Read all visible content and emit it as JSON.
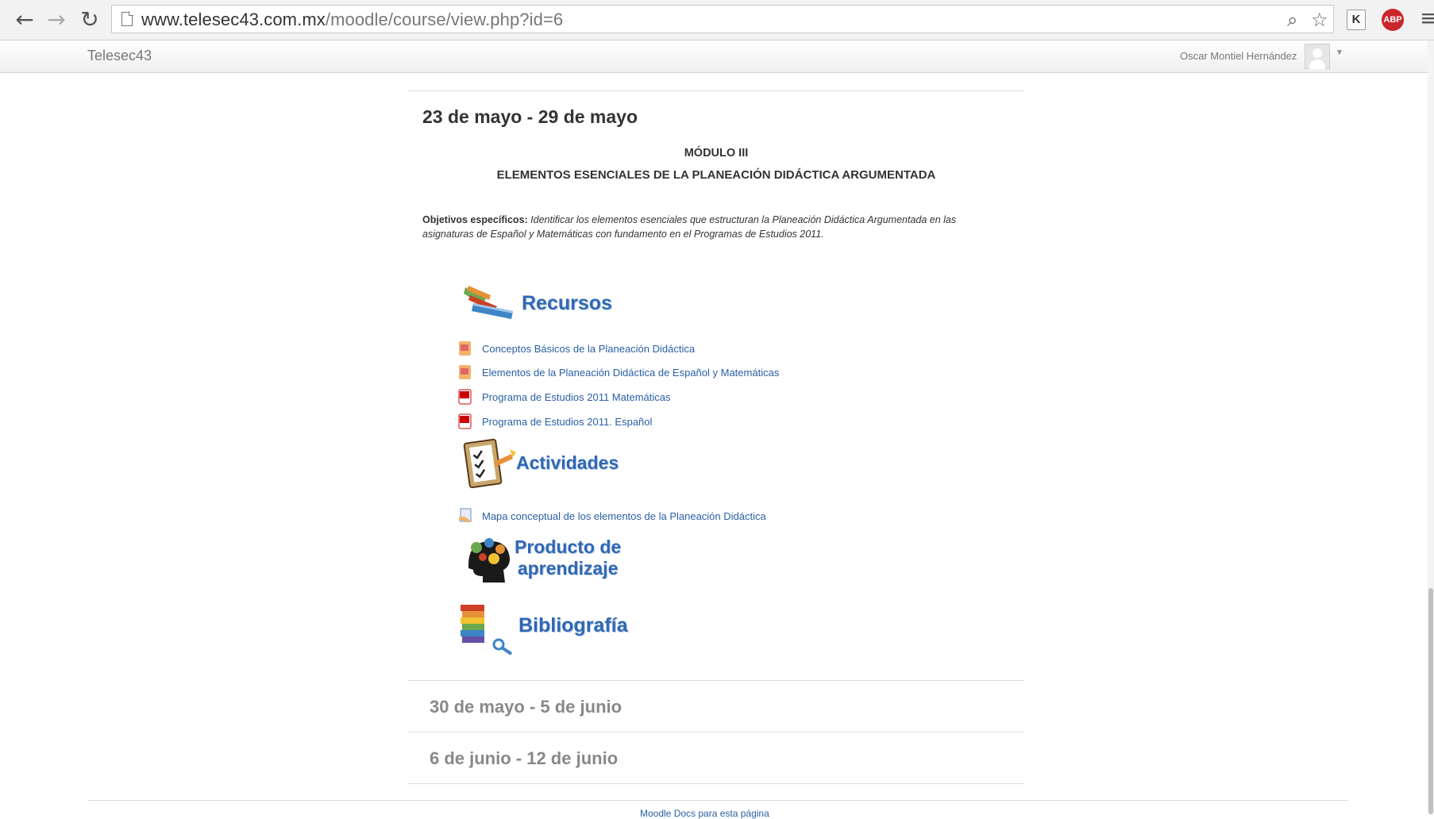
{
  "browser": {
    "url_host": "www.telesec43.com.mx",
    "url_path": "/moodle/course/view.php?id=6",
    "back_icon": "back-arrow-icon",
    "forward_icon": "forward-arrow-icon",
    "reload_icon": "reload-icon",
    "zoom_icon": "magnifier-icon",
    "star_icon": "bookmark-star-icon",
    "ext_k_label": "K",
    "ext_abp_label": "ABP",
    "menu_icon": "hamburger-menu-icon"
  },
  "navbar": {
    "brand": "Telesec43",
    "user_name": "Oscar Montiel Hernández"
  },
  "section": {
    "title": "23 de mayo - 29 de mayo",
    "module": "MÓDULO III",
    "subtitle": "ELEMENTOS ESENCIALES DE LA PLANEACIÓN DIDÁCTICA ARGUMENTADA",
    "objectives_label": "Objetivos específicos:",
    "objectives_text": "Identificar los elementos esenciales que estructuran la Planeación Didáctica Argumentada en las asignaturas de Español y Matemáticas con fundamento en el Programas de Estudios 2011."
  },
  "recursos": {
    "label": "Recursos",
    "items": [
      {
        "label": "Conceptos Básicos de la Planeación Didáctica",
        "icon": "powerpoint-icon"
      },
      {
        "label": "Elementos de la Planeación Didáctica de Español y Matemáticas",
        "icon": "powerpoint-icon"
      },
      {
        "label": "Programa de Estudios 2011 Matemáticas",
        "icon": "pdf-icon"
      },
      {
        "label": "Programa de Estudios 2011. Español",
        "icon": "pdf-icon"
      }
    ]
  },
  "actividades": {
    "label": "Actividades",
    "items": [
      {
        "label": "Mapa conceptual de los elementos de la Planeación Didáctica",
        "icon": "assignment-icon"
      }
    ]
  },
  "producto": {
    "label_line1": "Producto de",
    "label_line2": "aprendizaje"
  },
  "bibliografia": {
    "label": "Bibliografía"
  },
  "weeks": [
    {
      "label": "30 de mayo - 5 de junio"
    },
    {
      "label": "6 de junio - 12 de junio"
    }
  ],
  "footer": {
    "text": "Moodle Docs para esta página"
  },
  "colors": {
    "link": "#2a5fa5",
    "heading_blue": "#2f68b5"
  }
}
